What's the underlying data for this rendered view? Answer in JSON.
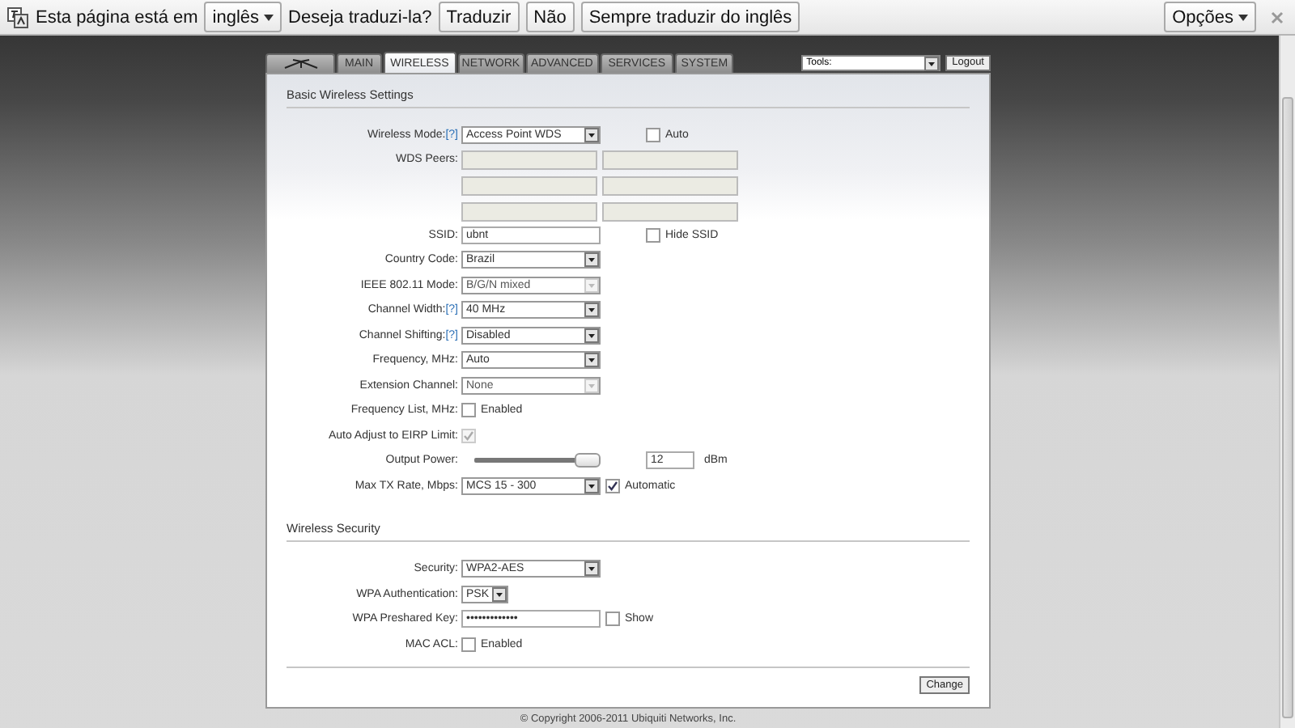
{
  "translate_bar": {
    "prompt": "Esta página está em",
    "language": "inglês",
    "question": "Deseja traduzi-la?",
    "buttons": [
      "Traduzir",
      "Não",
      "Sempre traduzir do inglês"
    ],
    "options": "Opções"
  },
  "tabs": [
    {
      "kind": "logo",
      "selected": false
    },
    {
      "kind": "text",
      "label": "MAIN",
      "selected": false
    },
    {
      "kind": "text",
      "label": "WIRELESS",
      "selected": true
    },
    {
      "kind": "text",
      "label": "NETWORK",
      "selected": false
    },
    {
      "kind": "text",
      "label": "ADVANCED",
      "selected": false
    },
    {
      "kind": "text",
      "label": "SERVICES",
      "selected": false
    },
    {
      "kind": "text",
      "label": "SYSTEM",
      "selected": false
    }
  ],
  "tools": {
    "value": "Tools:",
    "logout": "Logout"
  },
  "sections": [
    {
      "title": "Basic Wireless Settings",
      "rows": [
        {
          "label": "Wireless Mode:",
          "help": "[?]",
          "kind": "select",
          "value": "Access Point WDS",
          "disabled": false,
          "side": {
            "kind": "checkbox",
            "label": "Auto",
            "checked": false,
            "disabled": false
          }
        },
        {
          "label": "WDS Peers:",
          "kind": "peers",
          "fields": [
            {
              "disabled": true
            },
            {
              "disabled": true
            },
            {
              "disabled": true
            },
            {
              "disabled": true
            },
            {
              "disabled": true
            },
            {
              "disabled": true
            }
          ]
        },
        {
          "label": "SSID:",
          "kind": "text",
          "value": "ubnt",
          "side": {
            "kind": "checkbox",
            "label": "Hide SSID",
            "checked": false,
            "disabled": false
          }
        },
        {
          "label": "Country Code:",
          "kind": "select",
          "value": "Brazil",
          "disabled": false
        },
        {
          "label": "IEEE 802.11 Mode:",
          "kind": "select",
          "value": "B/G/N mixed",
          "disabled": true
        },
        {
          "label": "Channel Width:",
          "help": "[?]",
          "kind": "select",
          "value": "40 MHz",
          "disabled": false
        },
        {
          "label": "Channel Shifting:",
          "help": "[?]",
          "kind": "select",
          "value": "Disabled",
          "disabled": false
        },
        {
          "label": "Frequency, MHz:",
          "kind": "select",
          "value": "Auto",
          "disabled": false
        },
        {
          "label": "Extension Channel:",
          "kind": "select",
          "value": "None",
          "disabled": true
        },
        {
          "label": "Frequency List, MHz:",
          "kind": "checkbox",
          "label2": "Enabled",
          "checked": false,
          "disabled": false
        },
        {
          "label": "Auto Adjust to EIRP Limit:",
          "kind": "checkbox",
          "checked": true,
          "disabled": true
        },
        {
          "label": "Output Power:",
          "kind": "slider",
          "level": 1,
          "side": {
            "kind": "number",
            "value": "12",
            "unit": "dBm"
          }
        },
        {
          "label": "Max TX Rate, Mbps:",
          "kind": "select",
          "value": "MCS 15 - 300",
          "disabled": false,
          "extra": {
            "kind": "checkbox",
            "label": "Automatic",
            "checked": true,
            "disabled": false
          }
        }
      ]
    },
    {
      "title": "Wireless Security",
      "rows": [
        {
          "label": "Security:",
          "kind": "select",
          "value": "WPA2-AES",
          "disabled": false
        },
        {
          "label": "WPA Authentication:",
          "kind": "small_select",
          "value": "PSK",
          "disabled": false
        },
        {
          "label": "WPA Preshared Key:",
          "kind": "password",
          "value": "•••••••••••••",
          "extra": {
            "kind": "checkbox",
            "label": "Show",
            "checked": false,
            "disabled": false
          }
        },
        {
          "label": "MAC ACL:",
          "kind": "checkbox",
          "label2": "Enabled",
          "checked": false,
          "disabled": false
        }
      ]
    }
  ],
  "change_button": "Change",
  "copyright": "© Copyright 2006-2011 Ubiquiti Networks, Inc."
}
